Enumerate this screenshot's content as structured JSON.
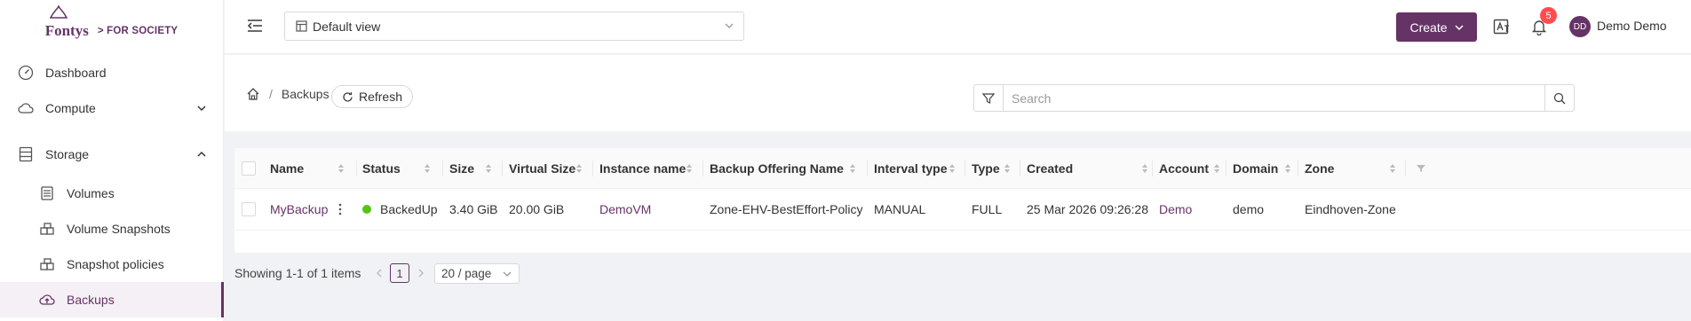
{
  "brand": {
    "name": "Fontys",
    "tagline": "> FOR SOCIETY"
  },
  "sidebar": {
    "items": [
      {
        "label": "Dashboard",
        "icon": "dashboard-icon"
      },
      {
        "label": "Compute",
        "icon": "cloud-icon"
      },
      {
        "label": "Storage",
        "icon": "database-icon"
      },
      {
        "label": "Volumes",
        "icon": "hdd-icon"
      },
      {
        "label": "Volume Snapshots",
        "icon": "build-icon"
      },
      {
        "label": "Snapshot policies",
        "icon": "build-icon"
      },
      {
        "label": "Backups",
        "icon": "cloud-upload-icon"
      }
    ]
  },
  "header": {
    "view_select": "Default view",
    "create_label": "Create",
    "notification_count": "5",
    "avatar_initials": "DD",
    "user_name": "Demo Demo"
  },
  "breadcrumb": {
    "current": "Backups",
    "separator": "/"
  },
  "toolbar": {
    "refresh_label": "Refresh",
    "search_placeholder": "Search"
  },
  "table": {
    "columns": [
      "Name",
      "Status",
      "Size",
      "Virtual Size",
      "Instance name",
      "Backup Offering Name",
      "Interval type",
      "Type",
      "Created",
      "Account",
      "Domain",
      "Zone"
    ],
    "rows": [
      {
        "name": "MyBackup",
        "status": "BackedUp",
        "size": "3.40 GiB",
        "virtual_size": "20.00 GiB",
        "instance_name": "DemoVM",
        "backup_offering": "Zone-EHV-BestEffort-Policy",
        "interval_type": "MANUAL",
        "type": "FULL",
        "created": "25 Mar 2026 09:26:28",
        "account": "Demo",
        "domain": "demo",
        "zone": "Eindhoven-Zone"
      }
    ]
  },
  "pagination": {
    "summary": "Showing 1-1 of 1 items",
    "current_page": "1",
    "page_size": "20 / page"
  },
  "colors": {
    "brand": "#663366",
    "success": "#52c41a",
    "badge": "#ff4d4f"
  }
}
